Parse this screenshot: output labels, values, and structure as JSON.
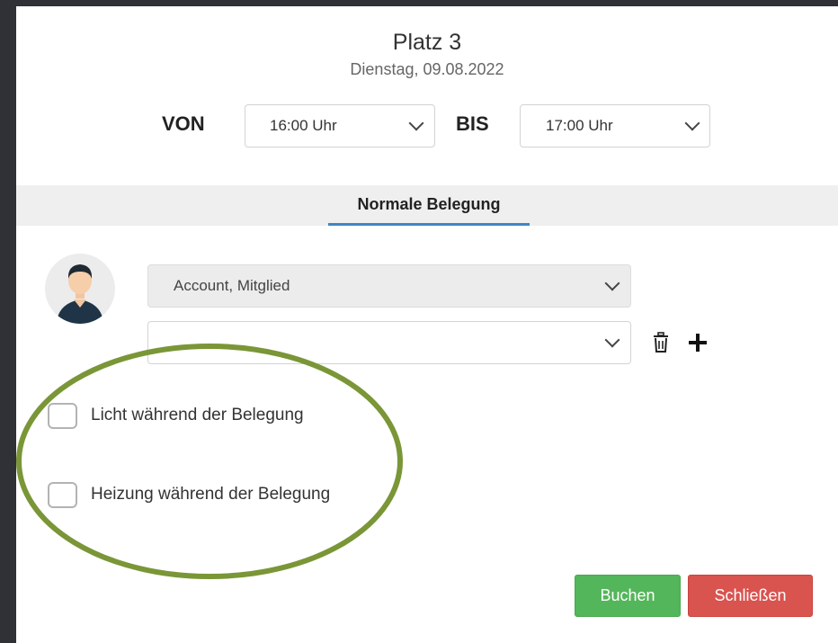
{
  "dialog": {
    "title": "Platz 3",
    "date": "Dienstag, 09.08.2022"
  },
  "time": {
    "from_label": "VON",
    "from_value": "16:00 Uhr",
    "to_label": "BIS",
    "to_value": "17:00 Uhr"
  },
  "tabs": [
    {
      "label": "Normale Belegung",
      "active": true
    }
  ],
  "booking": {
    "member_value": "Account, Mitglied",
    "second_member_value": ""
  },
  "options": [
    {
      "label": "Licht während der Belegung",
      "checked": false
    },
    {
      "label": "Heizung während der Belegung",
      "checked": false
    }
  ],
  "buttons": {
    "book": "Buchen",
    "close": "Schließen"
  },
  "colors": {
    "tab_underline": "#3f86c4",
    "book_button": "#54b65a",
    "close_button": "#d9534f",
    "annotation_ellipse": "#7a9637"
  },
  "icons": [
    "user-avatar",
    "chevron-down-icon",
    "trash-icon",
    "plus-icon"
  ]
}
